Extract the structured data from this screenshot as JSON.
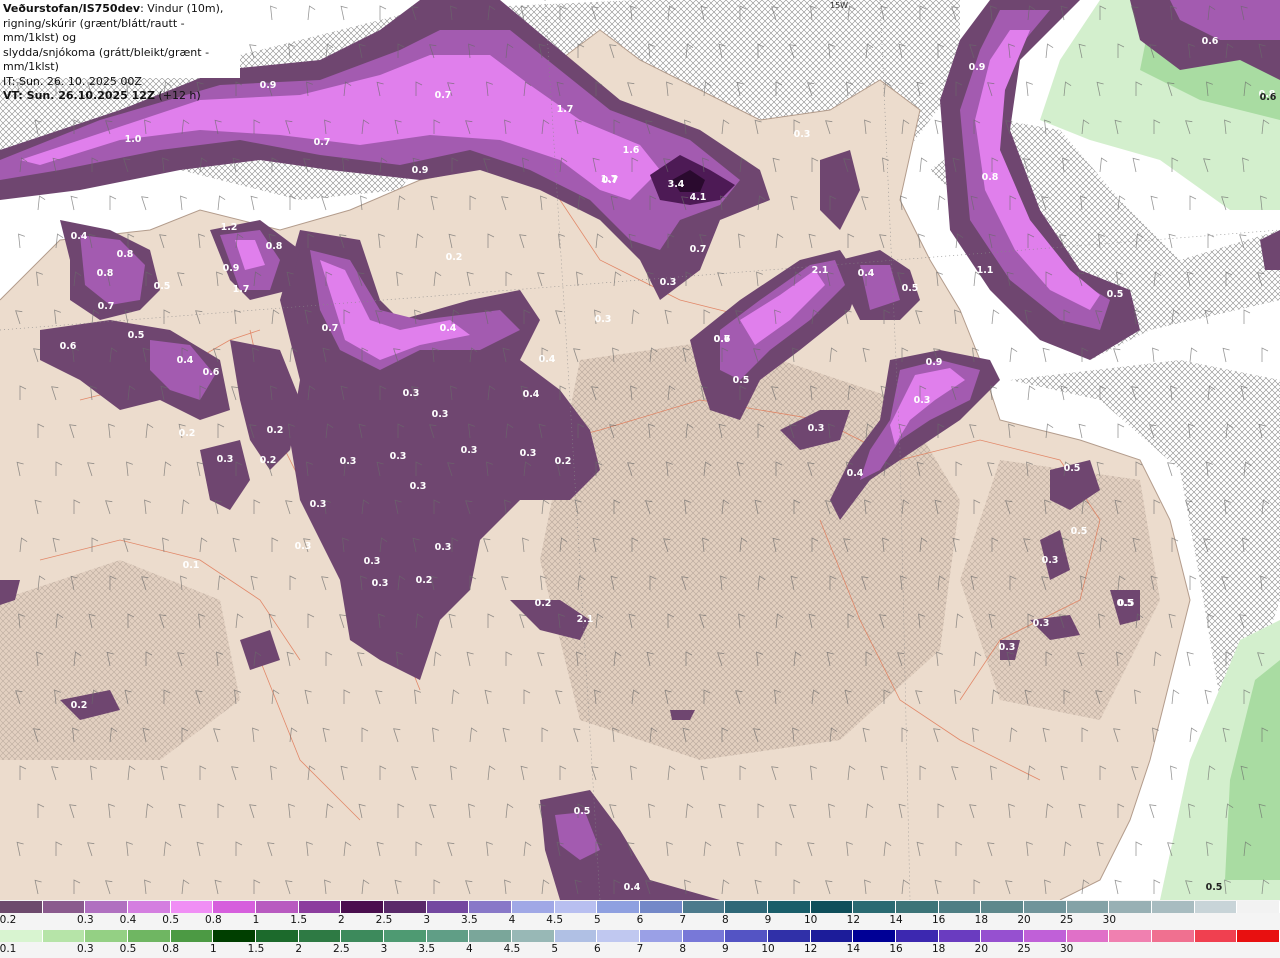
{
  "header": {
    "title_bold": "Veðurstofan/IS750dev",
    "title_rest": ": Vindur (10m),",
    "line2": "rigning/skúrir (grænt/blátt/rautt - mm/1klst) og",
    "line3": "slydda/snjókoma (grátt/bleikt/grænt - mm/1klst)",
    "issue_time": "IT: Sun. 26. 10. 2025 00Z",
    "valid_time_bold": "VT: Sun. 26.10.2025 12Z",
    "valid_time_rest": " (+12 h)"
  },
  "map": {
    "compass_label": "15W",
    "colors": {
      "sea": "#ffffff",
      "land": "#ecdccd",
      "roads": "#e07a58",
      "sleet_dark": "#6f4670",
      "sleet_mid": "#9a4fa4",
      "sleet_bright": "#e280ee",
      "sleet_peak": "#4d1a55",
      "rain_light": "#c8eac2",
      "rain_mid": "#8fd08a"
    },
    "value_labels": [
      "0.9",
      "0.7",
      "1.0",
      "0.7",
      "0.9",
      "0.7",
      "1.7",
      "1.6",
      "1.7",
      "3.4",
      "4.1",
      "0.7",
      "0.3",
      "0.3",
      "0.8",
      "0.9",
      "0.6",
      "0.8",
      "1.1",
      "0.5",
      "0.6",
      "0.4",
      "0.8",
      "0.8",
      "0.5",
      "0.7",
      "0.5",
      "0.6",
      "0.4",
      "0.6",
      "1.2",
      "0.8",
      "0.9",
      "1.7",
      "0.7",
      "0.4",
      "0.2",
      "0.3",
      "0.4",
      "0.3",
      "0.3",
      "0.3",
      "0.4",
      "0.3",
      "0.2",
      "0.3",
      "0.3",
      "0.3",
      "0.3",
      "0.3",
      "0.3",
      "0.3",
      "0.2",
      "0.3",
      "0.2",
      "2.1",
      "2.1",
      "0.4",
      "0.5",
      "0.5",
      "0.7",
      "0.9",
      "0.3",
      "0.3",
      "0.4",
      "0.5",
      "0.5",
      "0.3",
      "0.5",
      "0.3",
      "0.3",
      "0.3",
      "0.2",
      "0.2",
      "0.5",
      "0.4",
      "0.5",
      "0.1",
      "0.2",
      "0.2",
      "0.3"
    ]
  },
  "legend_precip": {
    "colors": [
      "#6d4a6d",
      "#8a5a8d",
      "#b070c0",
      "#d47ee0",
      "#f08ff5",
      "#d65fdd",
      "#b85ac0",
      "#8c3d9e",
      "#4a0e4e",
      "#5a2a6a",
      "#7448a0",
      "#8878c8",
      "#a0a8e6",
      "#b8bff0",
      "#8fa0e0",
      "#7488c8",
      "#4c7a8c",
      "#2f6878",
      "#1a5e6a",
      "#0f4e5a",
      "#2a6a72",
      "#3c7478",
      "#4e7e84",
      "#5e888c",
      "#70949a",
      "#84a2a6",
      "#98b0b4",
      "#a8bcc0",
      "#c8d4d8",
      "#f2f2f2"
    ],
    "ticks": [
      "0.2",
      "0.3",
      "0.4",
      "0.5",
      "0.8",
      "1",
      "1.5",
      "2",
      "2.5",
      "3",
      "3.5",
      "4",
      "4.5",
      "5",
      "6",
      "7",
      "8",
      "9",
      "10",
      "12",
      "14",
      "16",
      "18",
      "20",
      "25",
      "30"
    ]
  },
  "legend_snow": {
    "colors": [
      "#d8f4d0",
      "#b6e4a8",
      "#94d084",
      "#6fb662",
      "#4c9a44",
      "#003f00",
      "#1c6a2c",
      "#2e7a44",
      "#3d8a5c",
      "#4e9a72",
      "#609e86",
      "#7aa69a",
      "#98b8b6",
      "#b0c0e4",
      "#c0c8f0",
      "#9aa0e6",
      "#7878d8",
      "#5454c4",
      "#3030a8",
      "#1c1c9a",
      "#000096",
      "#3c28b0",
      "#6a3cc0",
      "#9650d0",
      "#c060d8",
      "#e070c8",
      "#f080b0",
      "#f07090",
      "#f04050",
      "#e81010"
    ],
    "ticks": [
      "0.1",
      "0.3",
      "0.5",
      "0.8",
      "1",
      "1.5",
      "2",
      "2.5",
      "3",
      "3.5",
      "4",
      "4.5",
      "5",
      "6",
      "7",
      "8",
      "9",
      "10",
      "12",
      "14",
      "16",
      "18",
      "20",
      "25",
      "30"
    ]
  }
}
